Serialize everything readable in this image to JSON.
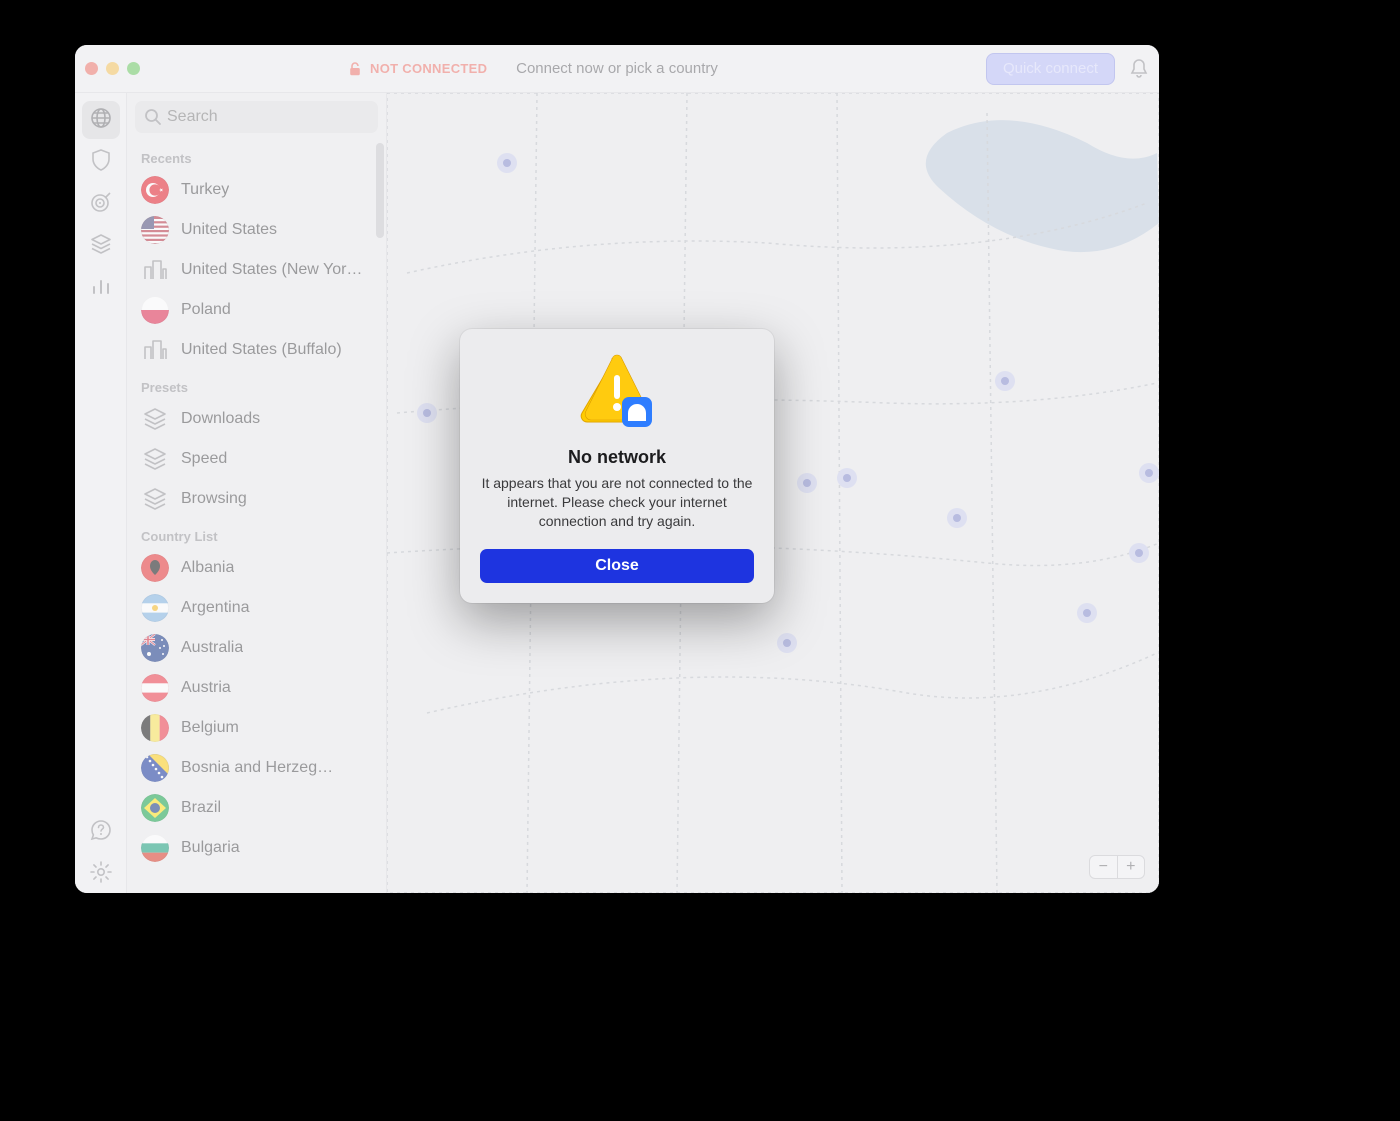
{
  "titlebar": {
    "status_label": "NOT CONNECTED",
    "center_text": "Connect now or pick a country",
    "quick_connect_label": "Quick connect",
    "status_color": "#ed6b60",
    "traffic_lights": {
      "close": "#ed6a5e",
      "min": "#f5bf4f",
      "max": "#61c554"
    }
  },
  "search": {
    "placeholder": "Search"
  },
  "sections": {
    "recents_label": "Recents",
    "presets_label": "Presets",
    "countries_label": "Country List"
  },
  "recents": [
    {
      "label": "Turkey",
      "type": "flag",
      "flag": "tr"
    },
    {
      "label": "United States",
      "type": "flag",
      "flag": "us"
    },
    {
      "label": "United States (New Yor…",
      "type": "city"
    },
    {
      "label": "Poland",
      "type": "flag",
      "flag": "pl"
    },
    {
      "label": "United States (Buffalo)",
      "type": "city"
    }
  ],
  "presets": [
    {
      "label": "Downloads"
    },
    {
      "label": "Speed"
    },
    {
      "label": "Browsing"
    }
  ],
  "countries": [
    {
      "label": "Albania",
      "flag": "al"
    },
    {
      "label": "Argentina",
      "flag": "ar"
    },
    {
      "label": "Australia",
      "flag": "au"
    },
    {
      "label": "Austria",
      "flag": "at"
    },
    {
      "label": "Belgium",
      "flag": "be"
    },
    {
      "label": "Bosnia and Herzeg…",
      "flag": "ba"
    },
    {
      "label": "Brazil",
      "flag": "br"
    },
    {
      "label": "Bulgaria",
      "flag": "bg"
    }
  ],
  "modal": {
    "title": "No network",
    "message": "It appears that you are not connected to the internet. Please check your internet connection and try again.",
    "button": "Close"
  },
  "zoom": {
    "out": "−",
    "in": "+"
  },
  "rail_icons": [
    "globe",
    "shield",
    "target",
    "layers",
    "bars"
  ],
  "rail_bottom_icons": [
    "help",
    "settings"
  ]
}
